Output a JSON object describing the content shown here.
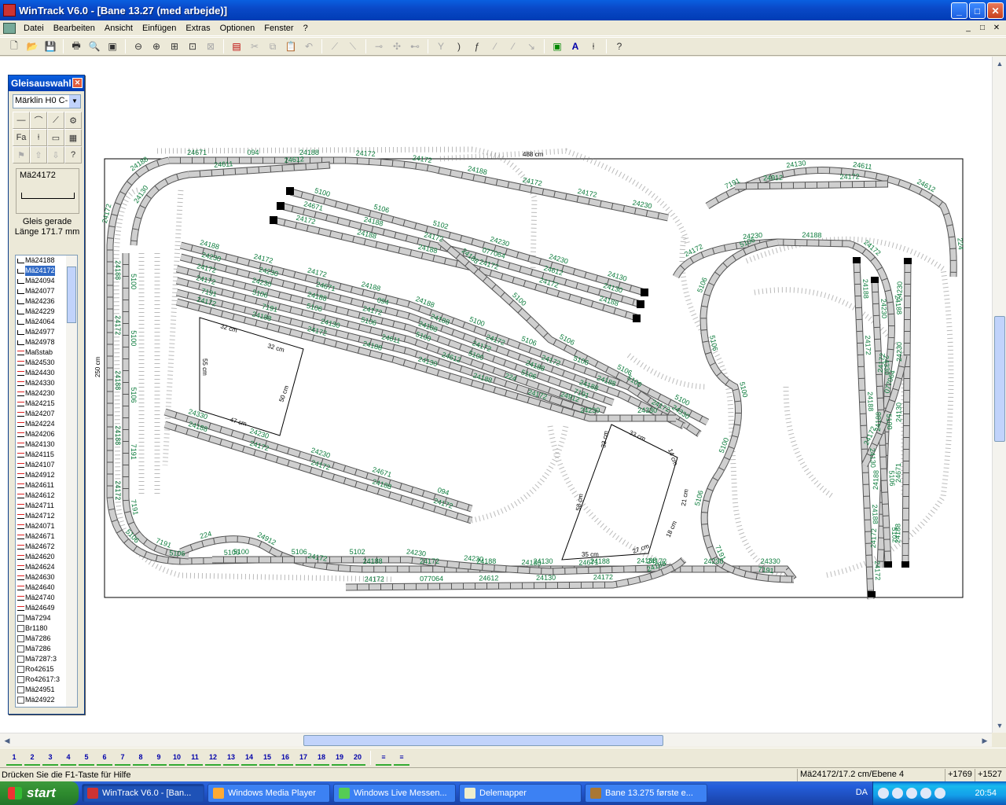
{
  "window": {
    "title": "WinTrack  V6.0 - [Bane 13.27 (med arbejde)]",
    "min": "_",
    "max": "□",
    "close": "✕"
  },
  "menu": [
    "Datei",
    "Bearbeiten",
    "Ansicht",
    "Einfügen",
    "Extras",
    "Optionen",
    "Fenster",
    "?"
  ],
  "palette": {
    "title": "Gleisauswahl",
    "system": "Märklin H0 C-",
    "preview_name": "Mä24172",
    "desc_line1": "Gleis gerade",
    "desc_line2": "Länge 171.7 mm",
    "items": [
      "Mä24188",
      "Mä24172",
      "Mä24094",
      "Mä24077",
      "Mä24236",
      "Mä24229",
      "Mä24064",
      "Mä24977",
      "Mä24978",
      "Maßstab",
      "Mä24530",
      "Mä24430",
      "Mä24330",
      "Mä24230",
      "Mä24215",
      "Mä24207",
      "Mä24224",
      "Mä24206",
      "Mä24130",
      "Mä24115",
      "Mä24107",
      "Mä24912",
      "Mä24611",
      "Mä24612",
      "Mä24711",
      "Mä24712",
      "Mä24071",
      "Mä24671",
      "Mä24672",
      "Mä24620",
      "Mä24624",
      "Mä24630",
      "Mä24640",
      "Mä24740",
      "Mä24649",
      "Mä7294",
      "Br1180",
      "Mä7286",
      "Mä7286",
      "Mä7287:3",
      "Ro42615",
      "Ro42617:3",
      "Mä24951",
      "Mä24922"
    ],
    "selected_index": 1
  },
  "drawing": {
    "dim_width": "488 cm",
    "dim_height": "250 cm",
    "measures": [
      "55 cm",
      "32 cm",
      "32 cm",
      "50 cm",
      "47 cm",
      "33 cm",
      "33 cm",
      "14 cm",
      "21 cm",
      "18 cm",
      "27 cm",
      "35 cm",
      "58 cm"
    ],
    "track_labels": [
      "24671",
      "094",
      "24188",
      "24172",
      "24172",
      "24188",
      "24172",
      "24172",
      "24230",
      "24188",
      "24172",
      "24188",
      "24172",
      "24188",
      "24188",
      "24172",
      "5106",
      "5106",
      "5106",
      "5100",
      "5100",
      "5106",
      "7191",
      "7191",
      "7191",
      "24130",
      "24611",
      "24612",
      "224",
      "24912",
      "24172",
      "24188",
      "24172",
      "24188",
      "24130",
      "24188",
      "24172",
      "24230",
      "24330",
      "5100",
      "5106",
      "5102",
      "24230",
      "24230",
      "24130",
      "24671",
      "24188",
      "24172",
      "077064",
      "24612",
      "24130",
      "24172",
      "24188",
      "24188",
      "24172",
      "24172",
      "24188",
      "24188",
      "5100",
      "5106",
      "5106",
      "5100",
      "24330",
      "24230",
      "24230"
    ]
  },
  "statusbar": {
    "help": "Drücken Sie die  F1-Taste für Hilfe",
    "item": "Mä24172/17.2 cm/Ebene 4",
    "x": "+1769",
    "y": "+1527"
  },
  "layers": [
    "1",
    "2",
    "3",
    "4",
    "5",
    "6",
    "7",
    "8",
    "9",
    "10",
    "11",
    "12",
    "13",
    "14",
    "15",
    "16",
    "17",
    "18",
    "19",
    "20"
  ],
  "taskbar": {
    "start": "start",
    "tasks": [
      "WinTrack  V6.0 - [Ban...",
      "Windows Media Player",
      "Windows Live Messen...",
      "Delemapper",
      "Bane 13.275 første e..."
    ],
    "lang": "DA",
    "clock": "20:54"
  }
}
